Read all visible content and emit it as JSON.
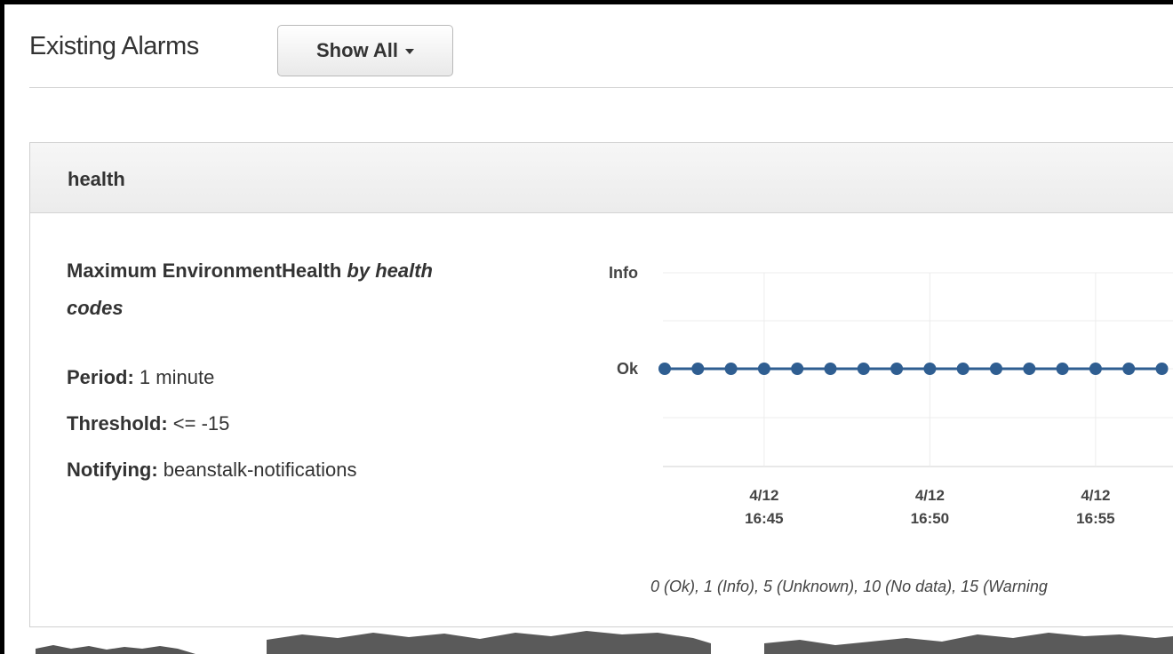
{
  "header": {
    "title": "Existing Alarms",
    "filter_button": {
      "label": "Show All",
      "icon": "caret-down-icon"
    }
  },
  "alarm": {
    "name": "health",
    "metric": {
      "stat_and_name": "Maximum EnvironmentHealth",
      "by_label": "by health codes"
    },
    "period": {
      "label": "Period:",
      "value": "1 minute"
    },
    "threshold": {
      "label": "Threshold:",
      "value": "<= -15"
    },
    "notifying": {
      "label": "Notifying:",
      "value": "beanstalk-notifications"
    }
  },
  "chart_data": {
    "type": "line",
    "y_ticks": [
      "Info",
      "Ok"
    ],
    "x_ticks": [
      {
        "date": "4/12",
        "time": "16:45"
      },
      {
        "date": "4/12",
        "time": "16:50"
      },
      {
        "date": "4/12",
        "time": "16:55"
      }
    ],
    "series": [
      {
        "x": [
          "16:42",
          "16:43",
          "16:44",
          "16:45",
          "16:46",
          "16:47",
          "16:48",
          "16:49",
          "16:50",
          "16:51",
          "16:52",
          "16:53",
          "16:54",
          "16:55",
          "16:56",
          "16:57"
        ],
        "values": [
          0,
          0,
          0,
          0,
          0,
          0,
          0,
          0,
          0,
          0,
          0,
          0,
          0,
          0,
          0,
          0
        ]
      }
    ],
    "ylim": [
      0,
      1
    ],
    "grid": true,
    "color": "#2f5e91",
    "legend_text": "0 (Ok), 1 (Info), 5 (Unknown), 10 (No data), 15 (Warning"
  }
}
